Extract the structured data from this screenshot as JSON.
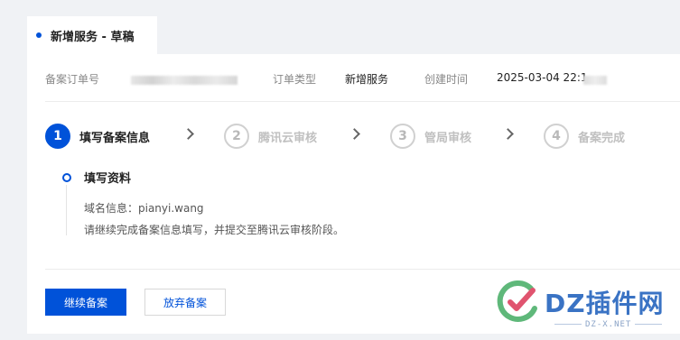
{
  "tab": {
    "title": "新增服务 - 草稿"
  },
  "info": {
    "order_no_label": "备案订单号",
    "order_type_label": "订单类型",
    "order_type_value": "新增服务",
    "created_label": "创建时间",
    "created_value": "2025-03-04 22:1"
  },
  "steps": [
    {
      "number": "1",
      "label": "填写备案信息"
    },
    {
      "number": "2",
      "label": "腾讯云审核"
    },
    {
      "number": "3",
      "label": "管局审核"
    },
    {
      "number": "4",
      "label": "备案完成"
    }
  ],
  "timeline": {
    "title": "填写资料",
    "domain_line": "域名信息：pianyi.wang",
    "hint": "请继续完成备案信息填写，并提交至腾讯云审核阶段。"
  },
  "buttons": {
    "continue": "继续备案",
    "abandon": "放弃备案"
  },
  "watermark": {
    "brand": "DZ插件网",
    "sub": "DZ-X.NET"
  },
  "colors": {
    "primary": "#0052d9",
    "watermark": "#3a73c4"
  }
}
